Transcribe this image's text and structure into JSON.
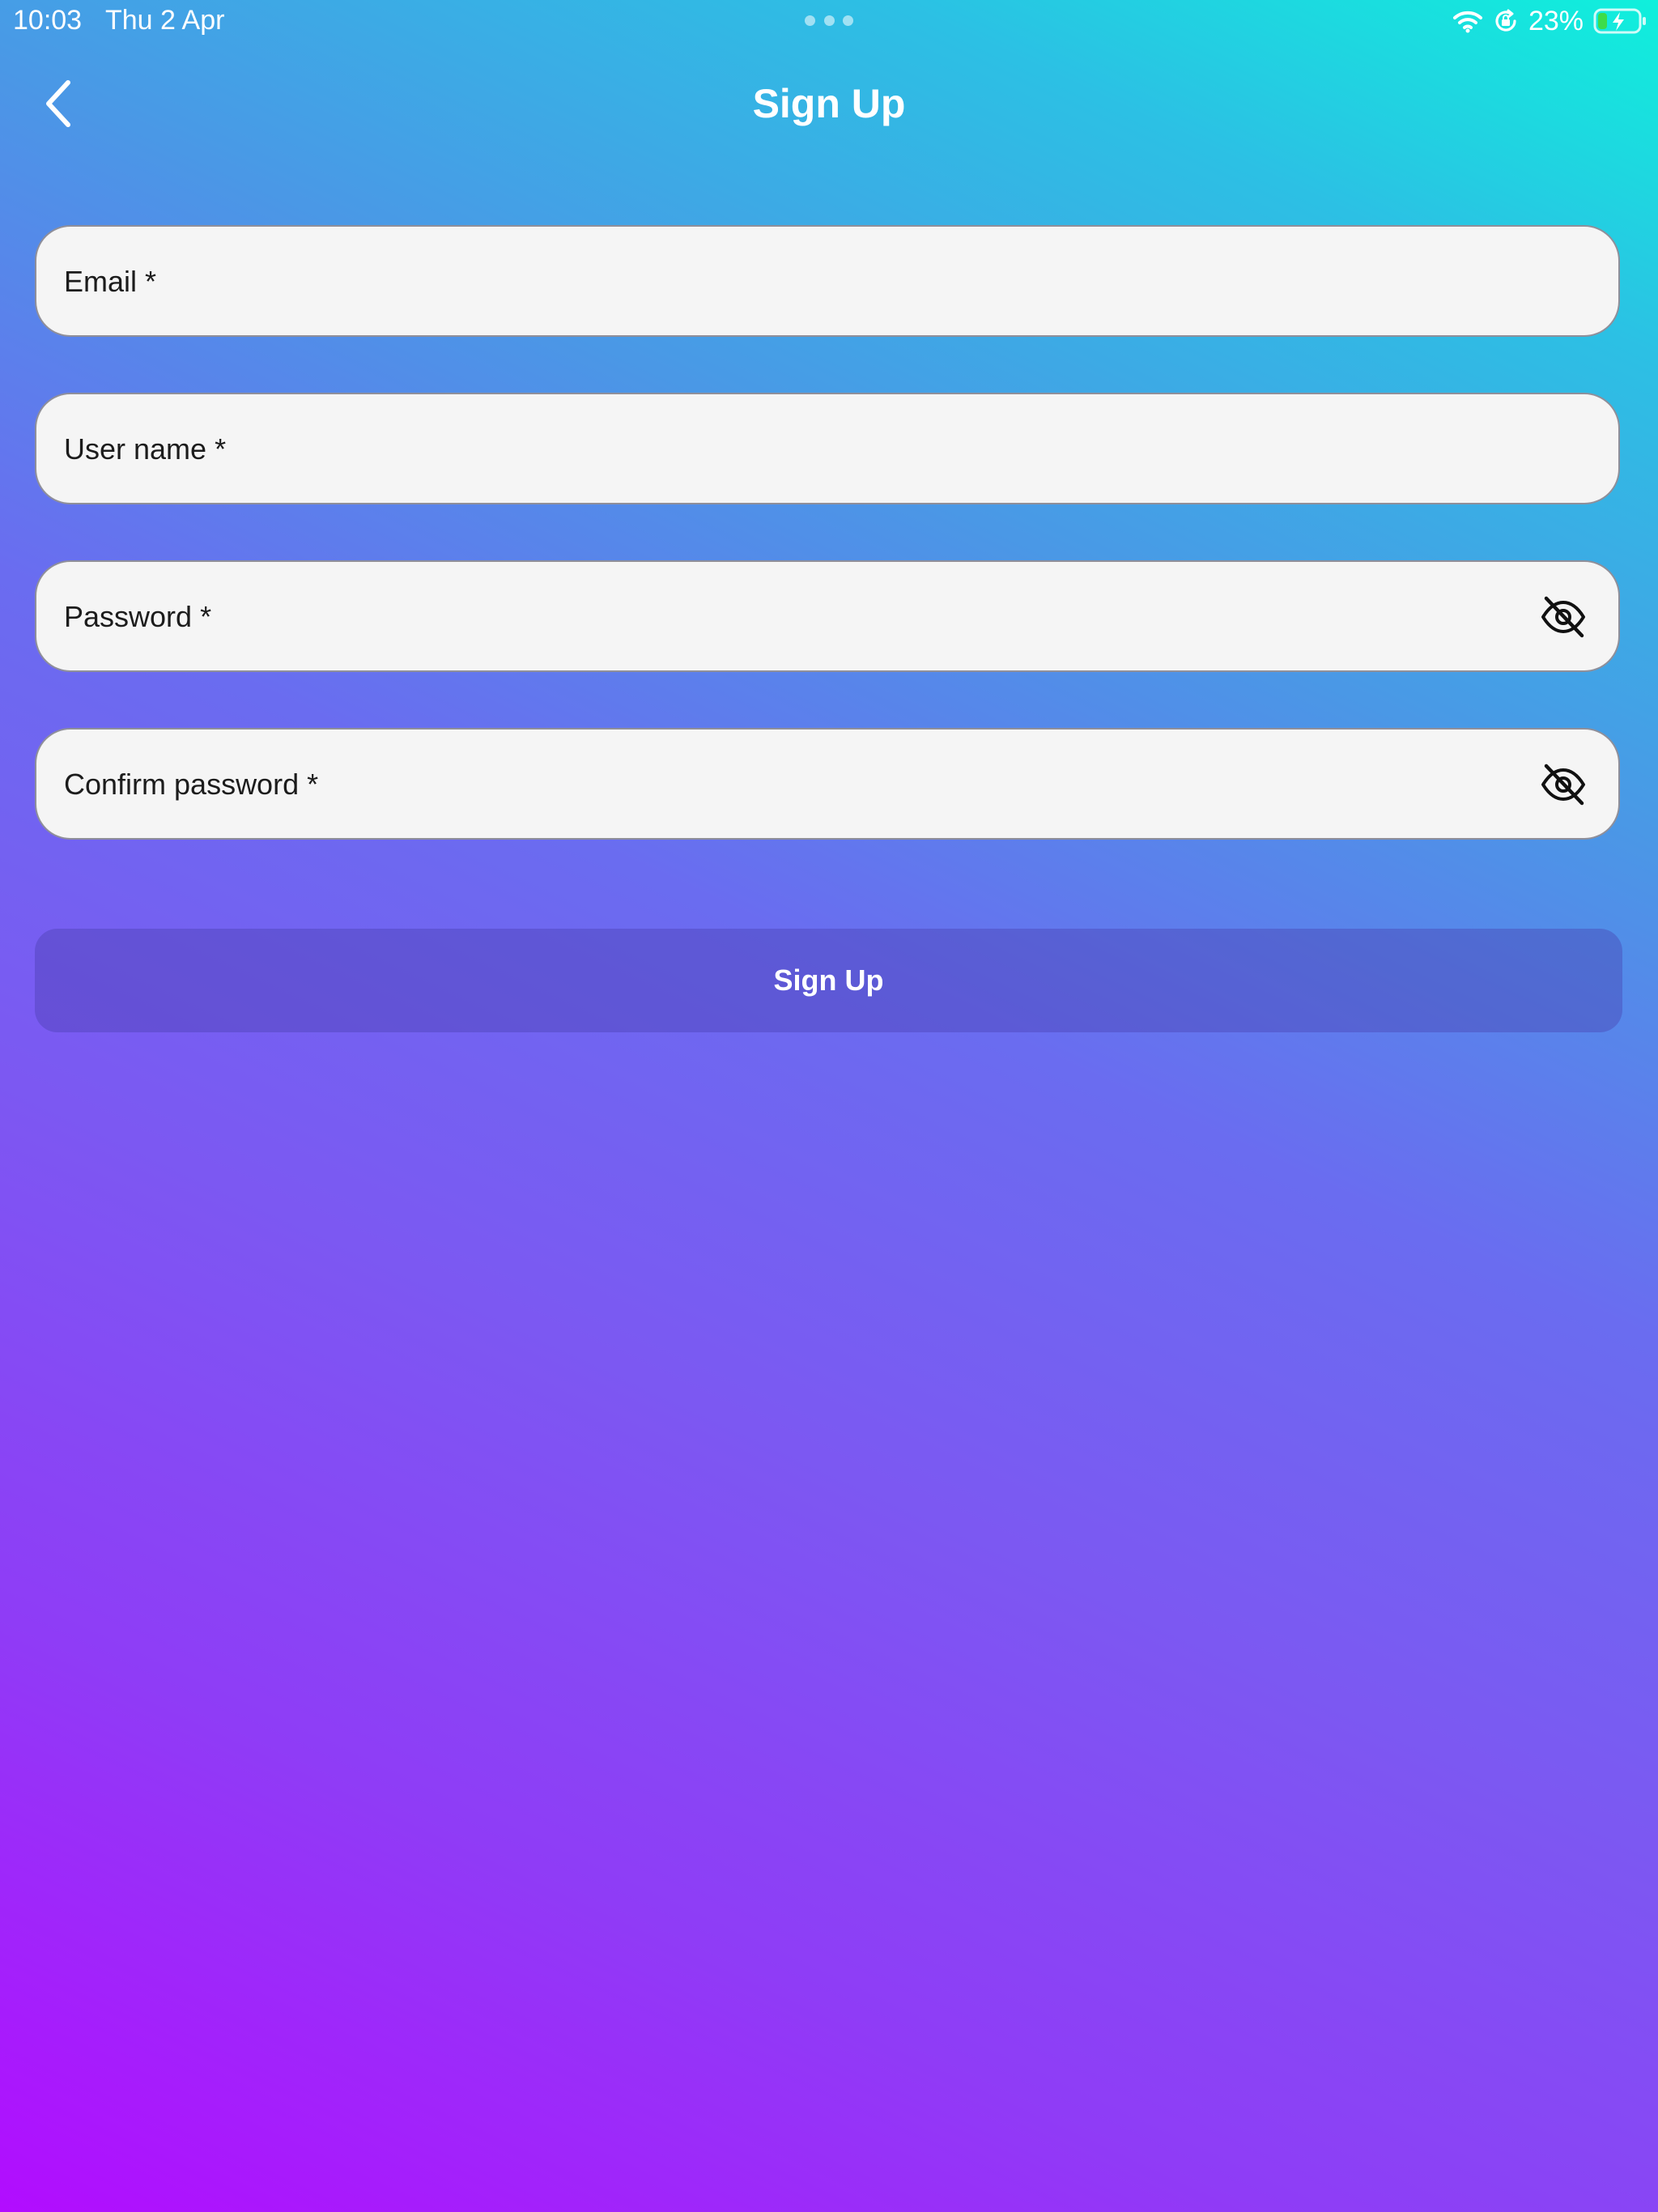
{
  "status_bar": {
    "time": "10:03",
    "date": "Thu 2 Apr",
    "battery_percent": "23%",
    "battery_level": 0.23,
    "icons": [
      "wifi-icon",
      "orientation-lock-icon",
      "battery-charging-icon"
    ]
  },
  "header": {
    "title": "Sign Up",
    "back_icon": "chevron-left-icon"
  },
  "form": {
    "email": {
      "placeholder": "Email *",
      "value": ""
    },
    "username": {
      "placeholder": "User name *",
      "value": ""
    },
    "password": {
      "placeholder": "Password *",
      "value": "",
      "toggle_icon": "eye-off-icon"
    },
    "confirm_password": {
      "placeholder": "Confirm password *",
      "value": "",
      "toggle_icon": "eye-off-icon"
    },
    "submit_label": "Sign Up"
  },
  "colors": {
    "gradient_top_right": "#0ff0dc",
    "gradient_bottom_left": "#b20cff",
    "field_background": "#f5f5f5",
    "battery_fill": "#3ddc4a"
  }
}
